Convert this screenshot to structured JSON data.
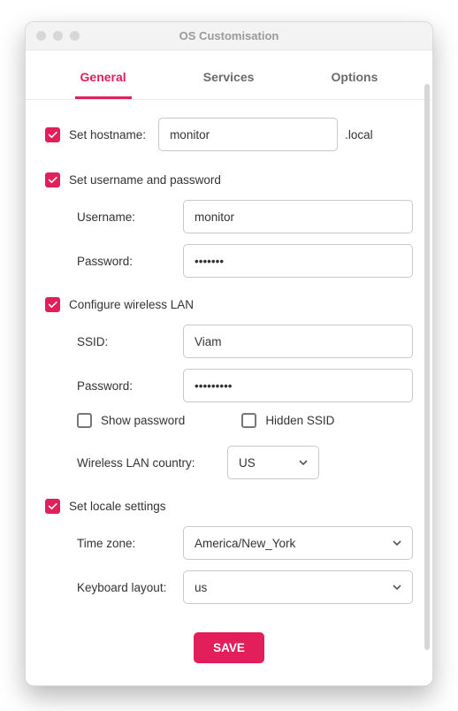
{
  "window": {
    "title": "OS Customisation"
  },
  "tabs": {
    "general": "General",
    "services": "Services",
    "options": "Options"
  },
  "hostname": {
    "label": "Set hostname:",
    "value": "monitor",
    "suffix": ".local"
  },
  "userpass": {
    "section": "Set username and password",
    "username_label": "Username:",
    "username_value": "monitor",
    "password_label": "Password:",
    "password_value": "•••••••"
  },
  "wifi": {
    "section": "Configure wireless LAN",
    "ssid_label": "SSID:",
    "ssid_value": "Viam",
    "password_label": "Password:",
    "password_value": "•••••••••",
    "show_pw_label": "Show password",
    "hidden_ssid_label": "Hidden SSID",
    "country_label": "Wireless LAN country:",
    "country_value": "US"
  },
  "locale": {
    "section": "Set locale settings",
    "tz_label": "Time zone:",
    "tz_value": "America/New_York",
    "kb_label": "Keyboard layout:",
    "kb_value": "us"
  },
  "buttons": {
    "save": "SAVE"
  }
}
